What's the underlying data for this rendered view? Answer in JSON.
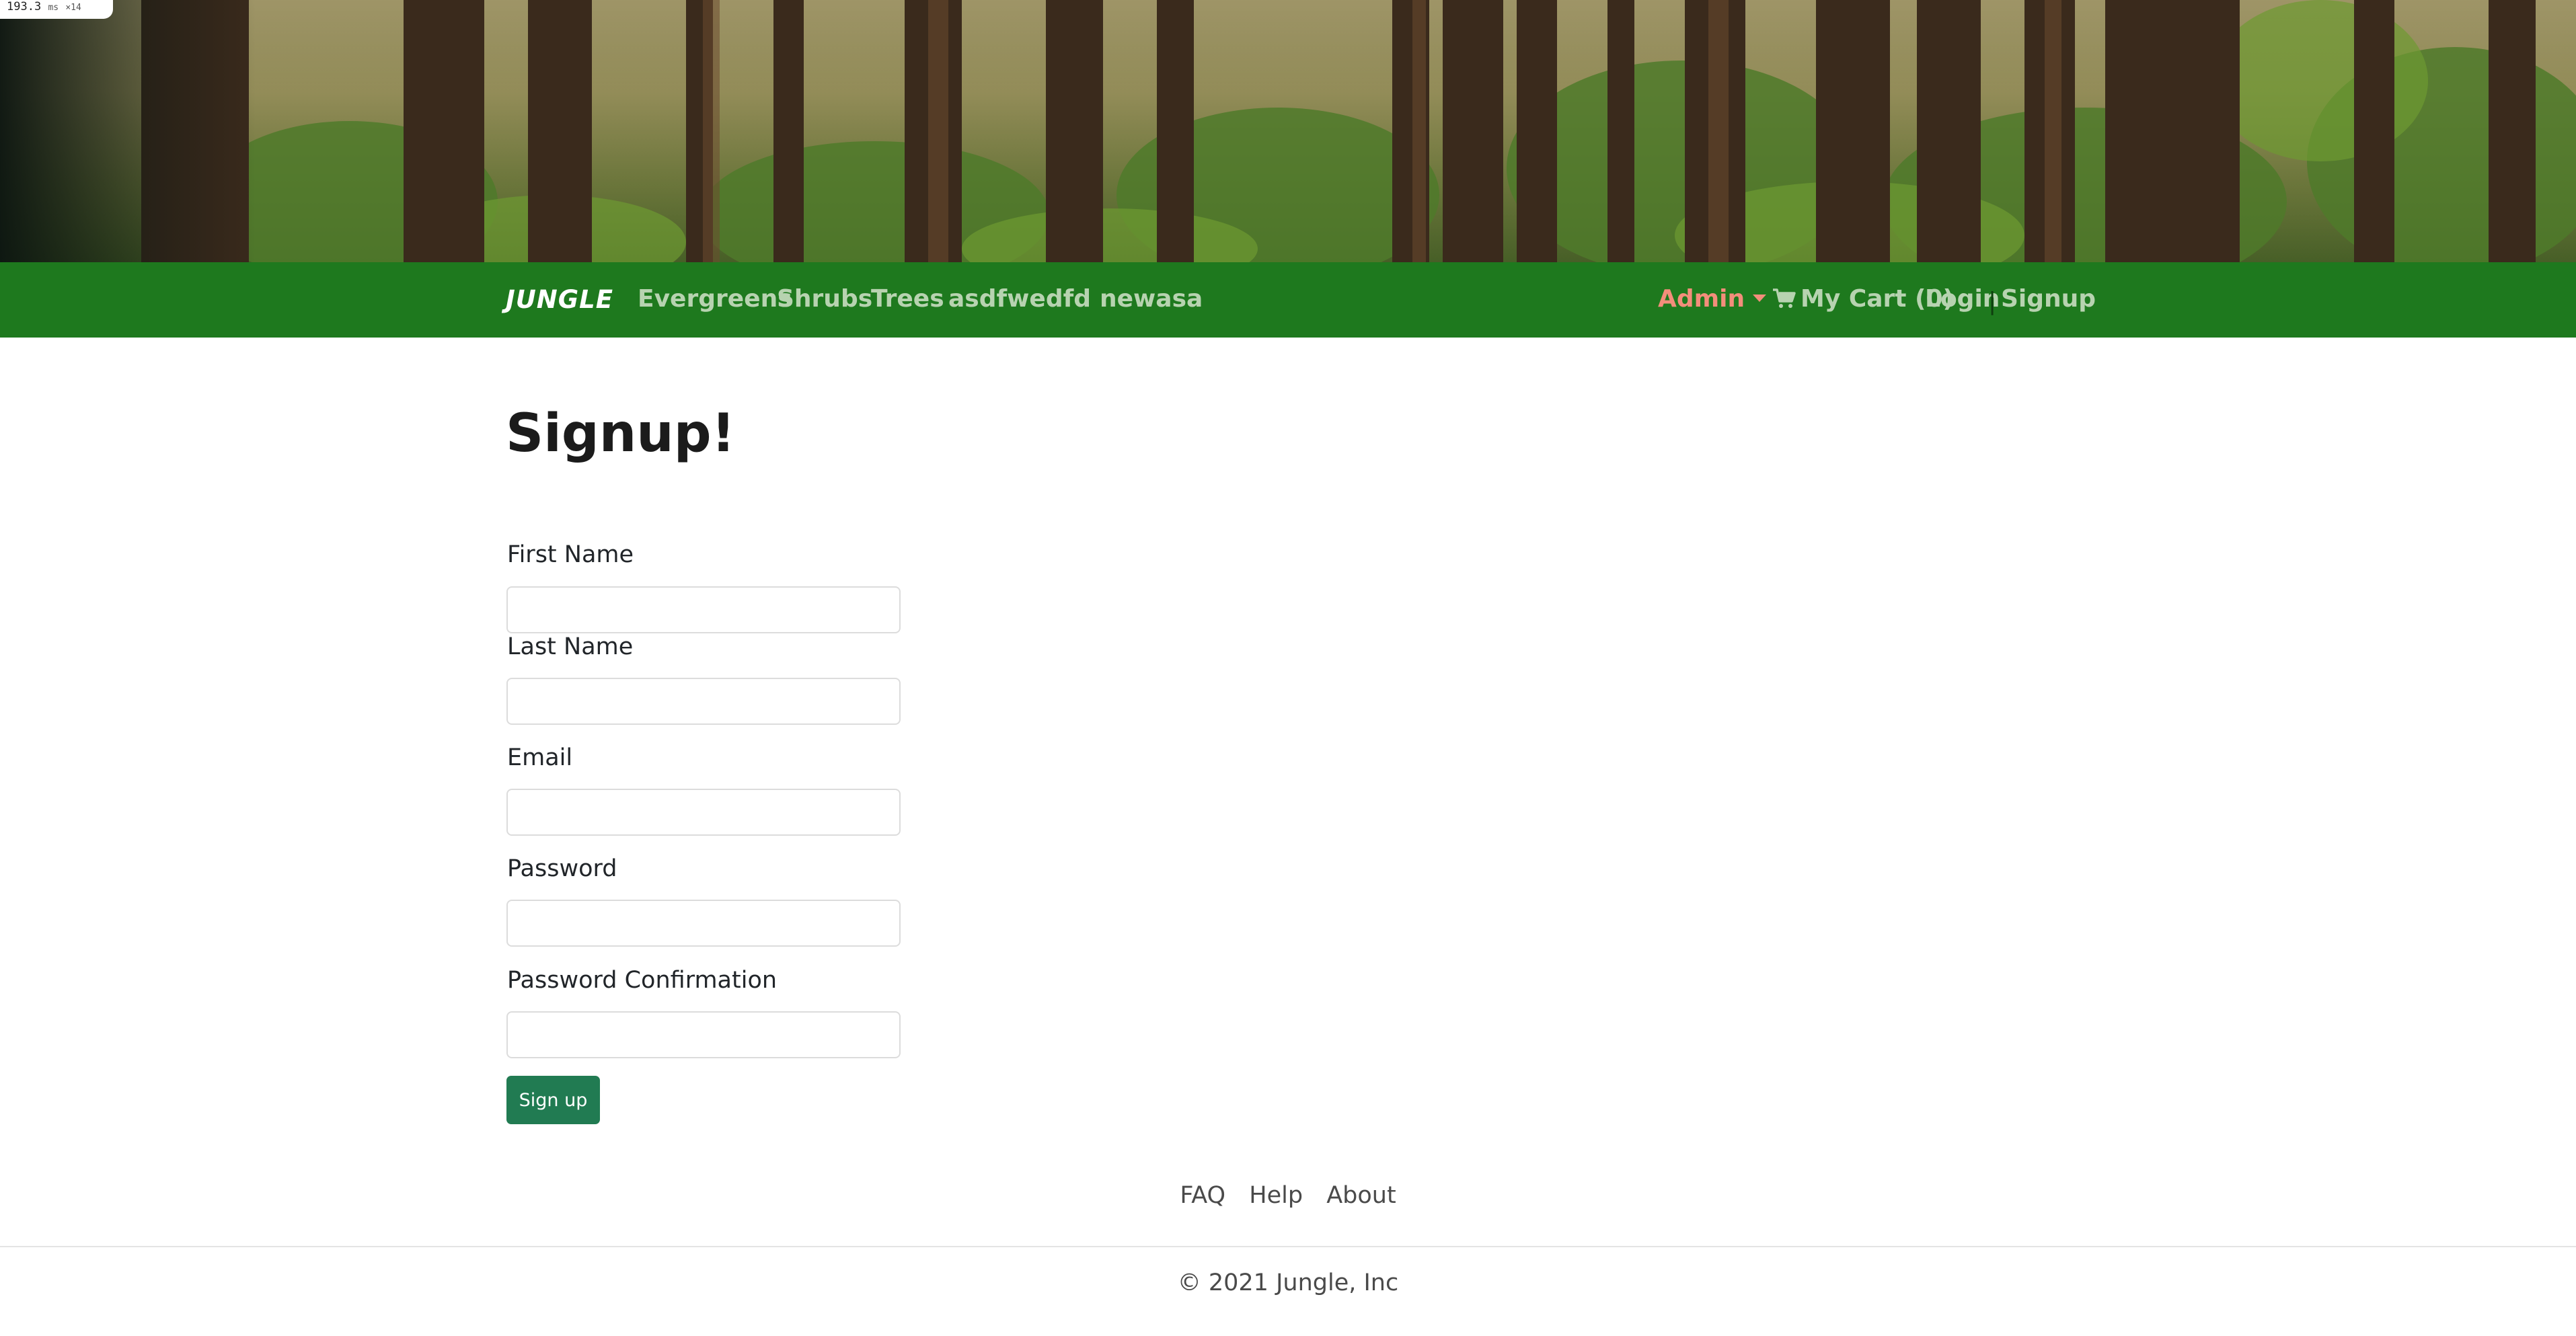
{
  "debug_badge": {
    "value": "193.3",
    "unit": "ms",
    "multiplier": "×14"
  },
  "nav": {
    "brand": "JUNGLE",
    "links": [
      "Evergreens",
      "Shrubs",
      "Trees",
      "asdfwedfd",
      "newasa"
    ],
    "admin": "Admin",
    "cart": "My Cart (0)",
    "login": "Login",
    "separator": "|",
    "signup": "Signup"
  },
  "form": {
    "title": "Signup!",
    "fields": [
      {
        "label": "First Name",
        "value": ""
      },
      {
        "label": "Last Name",
        "value": ""
      },
      {
        "label": "Email",
        "value": ""
      },
      {
        "label": "Password",
        "value": ""
      },
      {
        "label": "Password Confirmation",
        "value": ""
      }
    ],
    "submit_label": "Sign up"
  },
  "footer": {
    "links": [
      "FAQ",
      "Help",
      "About"
    ],
    "copyright": "© 2021 Jungle, Inc"
  },
  "colors": {
    "navbar": "#1e791e",
    "nav_link": "#b7d3b0",
    "admin_link": "#f38e7b",
    "submit_button": "#217b52"
  },
  "icons": {
    "cart": "shopping-cart-icon",
    "dropdown": "caret-down-icon"
  }
}
